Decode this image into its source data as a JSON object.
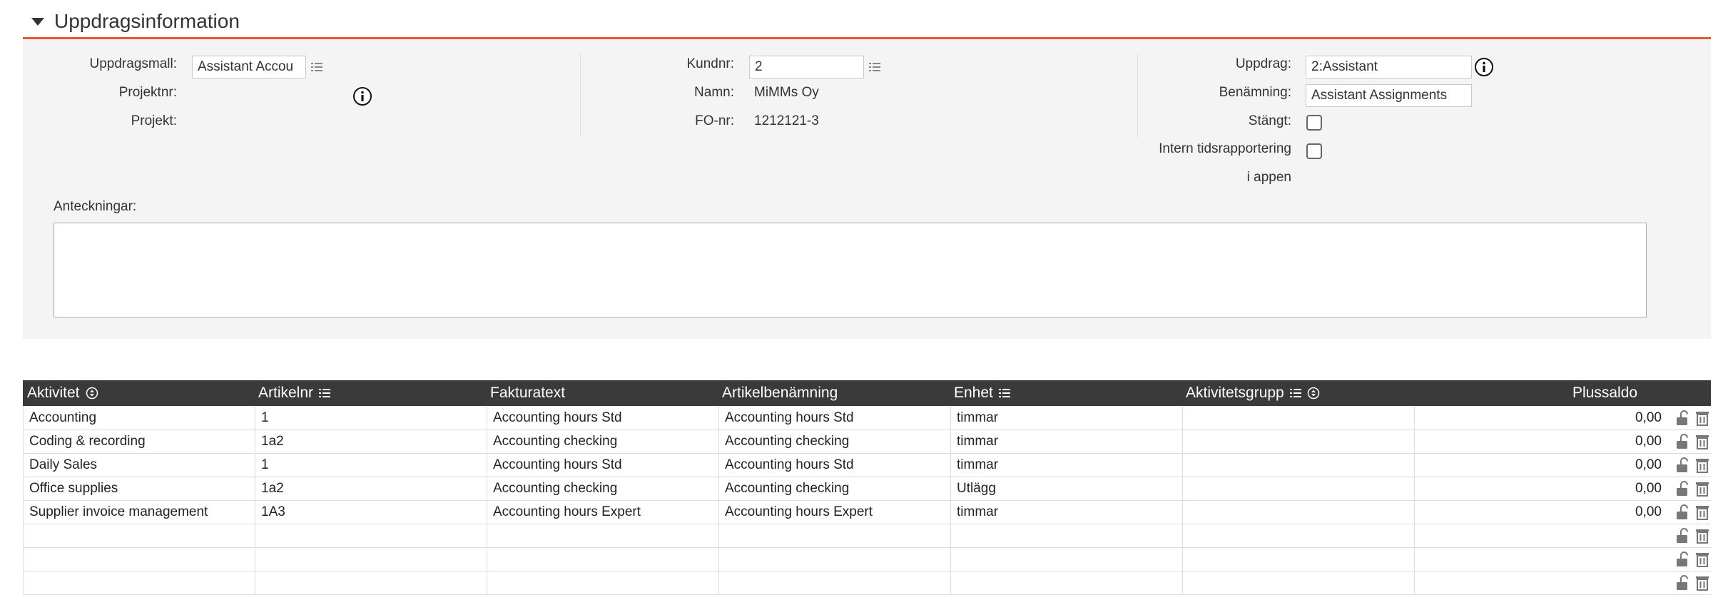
{
  "section": {
    "title": "Uppdragsinformation"
  },
  "col1": {
    "template_label": "Uppdragsmall:",
    "template_value": "Assistant Accou",
    "projectnr_label": "Projektnr:",
    "project_label": "Projekt:"
  },
  "col2": {
    "customer_label": "Kundnr:",
    "customer_value": "2",
    "name_label": "Namn:",
    "name_value": "MiMMs Oy",
    "fo_label": "FO-nr:",
    "fo_value": "1212121-3"
  },
  "col3": {
    "assignment_label": "Uppdrag:",
    "assignment_value": "2:Assistant",
    "designation_label": "Benämning:",
    "designation_value": "Assistant Assignments",
    "closed_label": "Stängt:",
    "internal_label_line1": "Intern tidsrapportering",
    "internal_label_line2": "i appen"
  },
  "notes": {
    "label": "Anteckningar:"
  },
  "table": {
    "headers": {
      "activity": "Aktivitet",
      "article_no": "Artikelnr",
      "invoice_text": "Fakturatext",
      "article_name": "Artikelbenämning",
      "unit": "Enhet",
      "activity_group": "Aktivitetsgrupp",
      "plus_balance": "Plussaldo"
    },
    "rows": [
      {
        "activity": "Accounting",
        "article_no": "1",
        "invoice_text": "Accounting hours Std",
        "article_name": "Accounting hours Std",
        "unit": "timmar",
        "activity_group": "",
        "plus_balance": "0,00"
      },
      {
        "activity": "Coding & recording",
        "article_no": "1a2",
        "invoice_text": "Accounting checking",
        "article_name": "Accounting checking",
        "unit": "timmar",
        "activity_group": "",
        "plus_balance": "0,00"
      },
      {
        "activity": "Daily Sales",
        "article_no": "1",
        "invoice_text": "Accounting hours Std",
        "article_name": "Accounting hours Std",
        "unit": "timmar",
        "activity_group": "",
        "plus_balance": "0,00"
      },
      {
        "activity": "Office supplies",
        "article_no": "1a2",
        "invoice_text": "Accounting checking",
        "article_name": "Accounting checking",
        "unit": "Utlägg",
        "activity_group": "",
        "plus_balance": "0,00"
      },
      {
        "activity": "Supplier invoice management",
        "article_no": "1A3",
        "invoice_text": "Accounting hours Expert",
        "article_name": "Accounting hours Expert",
        "unit": "timmar",
        "activity_group": "",
        "plus_balance": "0,00"
      },
      {
        "activity": "",
        "article_no": "",
        "invoice_text": "",
        "article_name": "",
        "unit": "",
        "activity_group": "",
        "plus_balance": ""
      },
      {
        "activity": "",
        "article_no": "",
        "invoice_text": "",
        "article_name": "",
        "unit": "",
        "activity_group": "",
        "plus_balance": ""
      },
      {
        "activity": "",
        "article_no": "",
        "invoice_text": "",
        "article_name": "",
        "unit": "",
        "activity_group": "",
        "plus_balance": ""
      }
    ]
  },
  "colors": {
    "accent": "#e8562a",
    "header_bg": "#3a3a3a",
    "panel_bg": "#f4f4f4"
  }
}
